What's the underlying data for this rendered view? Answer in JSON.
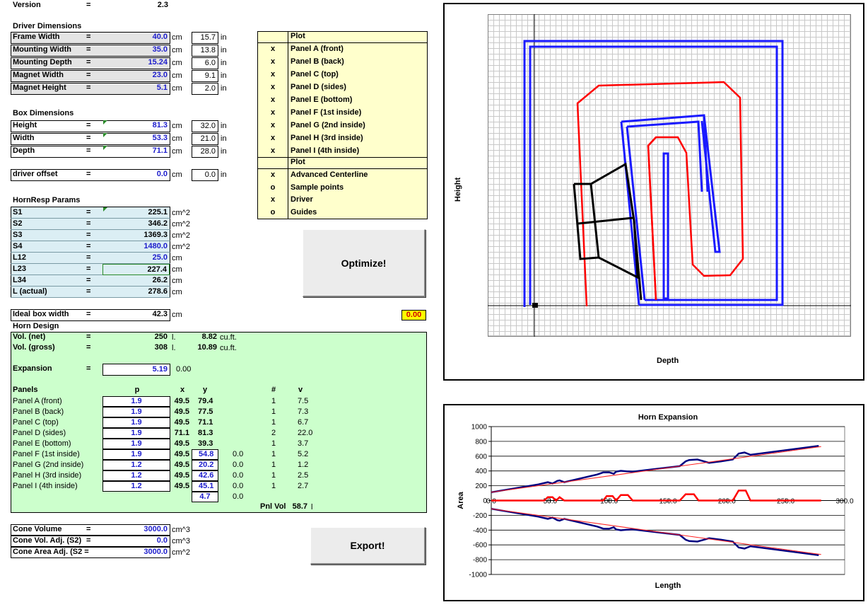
{
  "version": {
    "label": "Version",
    "eq": "=",
    "value": "2.3"
  },
  "driver": {
    "title": "Driver Dimensions",
    "rows": [
      {
        "label": "Frame Width",
        "cm": "40.0",
        "in": "15.7"
      },
      {
        "label": "Mounting Width",
        "cm": "35.0",
        "in": "13.8"
      },
      {
        "label": "Mounting Depth",
        "cm": "15.24",
        "in": "6.0"
      },
      {
        "label": "Magnet Width",
        "cm": "23.0",
        "in": "9.1"
      },
      {
        "label": "Magnet Height",
        "cm": "5.1",
        "in": "2.0"
      }
    ]
  },
  "box": {
    "title": "Box Dimensions",
    "rows": [
      {
        "label": "Height",
        "cm": "81.3",
        "in": "32.0"
      },
      {
        "label": "Width",
        "cm": "53.3",
        "in": "21.0"
      },
      {
        "label": "Depth",
        "cm": "71.1",
        "in": "28.0"
      }
    ]
  },
  "offset": {
    "label": "driver offset",
    "cm": "0.0",
    "in": "0.0"
  },
  "units": {
    "cm": "cm",
    "in": "in",
    "eq": "=",
    "cm2": "cm^2",
    "cm3": "cm^3",
    "l": "l.",
    "cuft": "cu.ft."
  },
  "hornresp": {
    "title": "HornResp Params",
    "rows": [
      {
        "label": "S1",
        "value": "225.1",
        "unit": "cm^2"
      },
      {
        "label": "S2",
        "value": "346.2",
        "unit": "cm^2"
      },
      {
        "label": "S3",
        "value": "1369.3",
        "unit": "cm^2"
      },
      {
        "label": "S4",
        "value": "1480.0",
        "unit": "cm^2"
      },
      {
        "label": "L12",
        "value": "25.0",
        "unit": "cm"
      },
      {
        "label": "L23",
        "value": "227.4",
        "unit": "cm"
      },
      {
        "label": "L34",
        "value": "26.2",
        "unit": "cm"
      },
      {
        "label": "L (actual)",
        "value": "278.6",
        "unit": "cm"
      }
    ]
  },
  "ideal": {
    "label": "Ideal box width",
    "value": "42.3",
    "unit": "cm",
    "flag": "0.00"
  },
  "horn": {
    "title": "Horn Design",
    "vol_net": {
      "label": "Vol. (net)",
      "l": "250",
      "cuft": "8.82"
    },
    "vol_gross": {
      "label": "Vol. (gross)",
      "l": "308",
      "cuft": "10.89"
    },
    "expansion": {
      "label": "Expansion",
      "value": "5.19",
      "extra": "0.00"
    },
    "headers": {
      "panels": "Panels",
      "p": "p",
      "x": "x",
      "y": "y",
      "n": "#",
      "v": "v"
    },
    "panels": [
      {
        "name": "Panel A (front)",
        "p": "1.9",
        "x": "49.5",
        "y": "79.4",
        "z": "",
        "n": "1",
        "v": "7.5"
      },
      {
        "name": "Panel B (back)",
        "p": "1.9",
        "x": "49.5",
        "y": "77.5",
        "z": "",
        "n": "1",
        "v": "7.3"
      },
      {
        "name": "Panel C (top)",
        "p": "1.9",
        "x": "49.5",
        "y": "71.1",
        "z": "",
        "n": "1",
        "v": "6.7"
      },
      {
        "name": "Panel D (sides)",
        "p": "1.9",
        "x": "71.1",
        "y": "81.3",
        "z": "",
        "n": "2",
        "v": "22.0"
      },
      {
        "name": "Panel E (bottom)",
        "p": "1.9",
        "x": "49.5",
        "y": "39.3",
        "z": "",
        "n": "1",
        "v": "3.7"
      },
      {
        "name": "Panel F (1st inside)",
        "p": "1.9",
        "x": "49.5",
        "y": "54.8",
        "z": "0.0",
        "n": "1",
        "v": "5.2"
      },
      {
        "name": "Panel G (2nd inside)",
        "p": "1.2",
        "x": "49.5",
        "y": "20.2",
        "z": "0.0",
        "n": "1",
        "v": "1.2"
      },
      {
        "name": "Panel H (3rd inside)",
        "p": "1.2",
        "x": "49.5",
        "y": "42.6",
        "z": "0.0",
        "n": "1",
        "v": "2.5"
      },
      {
        "name": "Panel I (4th inside)",
        "p": "1.2",
        "x": "49.5",
        "y": "45.1",
        "z": "0.0",
        "n": "1",
        "v": "2.7"
      }
    ],
    "extra_y": "4.7",
    "extra_z": "0.0",
    "pnl_vol_label": "Pnl Vol",
    "pnl_vol": "58.7",
    "pnl_vol_unit": "l"
  },
  "cone": [
    {
      "label": "Cone Volume",
      "eq": "=",
      "value": "3000.0",
      "unit": "cm^3"
    },
    {
      "label": "Cone Vol. Adj. (S2)",
      "eq": "=",
      "value": "0.0",
      "unit": "cm^3"
    },
    {
      "label": "Cone Area Adj. (S2 =",
      "eq": "",
      "value": "3000.0",
      "unit": "cm^2"
    }
  ],
  "plot_table": {
    "header1": "Plot",
    "items1": [
      {
        "mark": "x",
        "label": "Panel A (front)"
      },
      {
        "mark": "x",
        "label": "Panel B (back)"
      },
      {
        "mark": "x",
        "label": "Panel C (top)"
      },
      {
        "mark": "x",
        "label": "Panel D (sides)"
      },
      {
        "mark": "x",
        "label": "Panel E (bottom)"
      },
      {
        "mark": "x",
        "label": "Panel F (1st inside)"
      },
      {
        "mark": "x",
        "label": "Panel G (2nd inside)"
      },
      {
        "mark": "x",
        "label": "Panel H (3rd inside)"
      },
      {
        "mark": "x",
        "label": "Panel I (4th inside)"
      }
    ],
    "header2": "Plot",
    "items2": [
      {
        "mark": "x",
        "label": "Advanced Centerline"
      },
      {
        "mark": "o",
        "label": "Sample points"
      },
      {
        "mark": "x",
        "label": "Driver"
      },
      {
        "mark": "o",
        "label": "Guides"
      }
    ]
  },
  "buttons": {
    "optimize": "Optimize!",
    "export": "Export!"
  },
  "layout_chart": {
    "xlabel": "Depth",
    "ylabel": "Height"
  },
  "colors": {
    "panel_outer": "#1a1aff",
    "centerline": "#ff0000",
    "driver": "#000000",
    "gray_cell": "#e4e4e4",
    "blue_cell": "#dbeef4",
    "green_block": "#ccffcc",
    "yellow_block": "#ffffcc",
    "flag": "#ffff00"
  },
  "chart_data": {
    "type": "line",
    "title": "Horn Expansion",
    "xlabel": "Length",
    "ylabel": "Area",
    "xlim": [
      0,
      300
    ],
    "ylim": [
      -1000,
      1000
    ],
    "xticks": [
      "0.0",
      "50.0",
      "100.0",
      "150.0",
      "200.0",
      "250.0",
      "300.0"
    ],
    "yticks": [
      "1000",
      "800",
      "600",
      "400",
      "200",
      "0",
      "-200",
      "-400",
      "-600",
      "-800",
      "-1000"
    ],
    "series": [
      {
        "color": "#000080",
        "x": [
          0,
          40,
          48,
          52,
          56,
          58,
          62,
          90,
          95,
          100,
          104,
          106,
          110,
          115,
          120,
          160,
          165,
          168,
          175,
          185,
          195,
          205,
          210,
          215,
          220,
          278
        ],
        "y": [
          112,
          218,
          248,
          230,
          265,
          272,
          248,
          352,
          380,
          382,
          362,
          390,
          402,
          395,
          390,
          465,
          530,
          548,
          555,
          510,
          530,
          555,
          635,
          650,
          618,
          740
        ]
      },
      {
        "color": "#ff2020",
        "x": [
          0,
          280
        ],
        "y": [
          112,
          730
        ]
      },
      {
        "color": "#ff0000",
        "x": [
          0,
          45,
          48,
          52,
          55,
          58,
          62,
          95,
          98,
          103,
          106,
          110,
          116,
          120,
          160,
          165,
          172,
          176,
          205,
          210,
          216,
          220,
          280
        ],
        "y": [
          0,
          0,
          45,
          45,
          0,
          45,
          0,
          0,
          60,
          60,
          0,
          75,
          75,
          0,
          0,
          85,
          85,
          0,
          0,
          135,
          135,
          0,
          0
        ]
      },
      {
        "color": "#000080",
        "x": [
          0,
          40,
          48,
          52,
          56,
          58,
          62,
          90,
          95,
          100,
          104,
          106,
          110,
          115,
          120,
          160,
          165,
          168,
          175,
          185,
          195,
          205,
          210,
          215,
          220,
          278
        ],
        "y": [
          -112,
          -218,
          -248,
          -230,
          -265,
          -272,
          -248,
          -352,
          -380,
          -382,
          -362,
          -390,
          -402,
          -395,
          -390,
          -465,
          -530,
          -548,
          -555,
          -510,
          -530,
          -555,
          -635,
          -650,
          -618,
          -740
        ]
      },
      {
        "color": "#ff2020",
        "x": [
          0,
          280
        ],
        "y": [
          -112,
          -730
        ]
      }
    ]
  }
}
